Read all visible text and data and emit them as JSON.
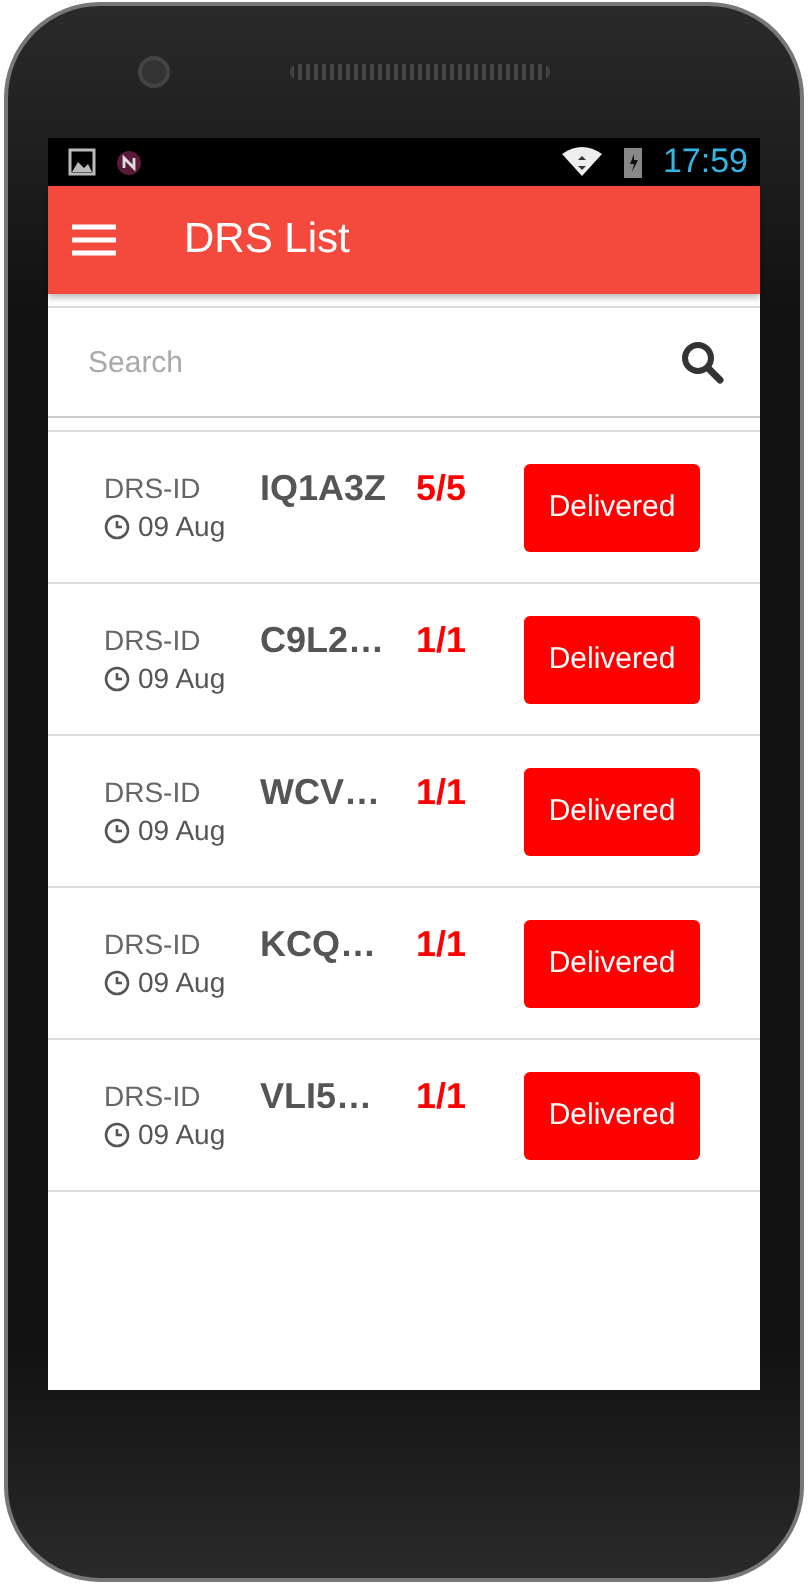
{
  "status_bar": {
    "time": "17:59"
  },
  "app_bar": {
    "title": "DRS List"
  },
  "search": {
    "placeholder": "Search"
  },
  "rows": [
    {
      "label": "DRS-ID",
      "date": "09 Aug",
      "id": "IQ1A3Z",
      "count": "5/5",
      "status": "Delivered"
    },
    {
      "label": "DRS-ID",
      "date": "09 Aug",
      "id": "C9L2…",
      "count": "1/1",
      "status": "Delivered"
    },
    {
      "label": "DRS-ID",
      "date": "09 Aug",
      "id": "WCV…",
      "count": "1/1",
      "status": "Delivered"
    },
    {
      "label": "DRS-ID",
      "date": "09 Aug",
      "id": "KCQ…",
      "count": "1/1",
      "status": "Delivered"
    },
    {
      "label": "DRS-ID",
      "date": "09 Aug",
      "id": "VLI5…",
      "count": "1/1",
      "status": "Delivered"
    }
  ]
}
